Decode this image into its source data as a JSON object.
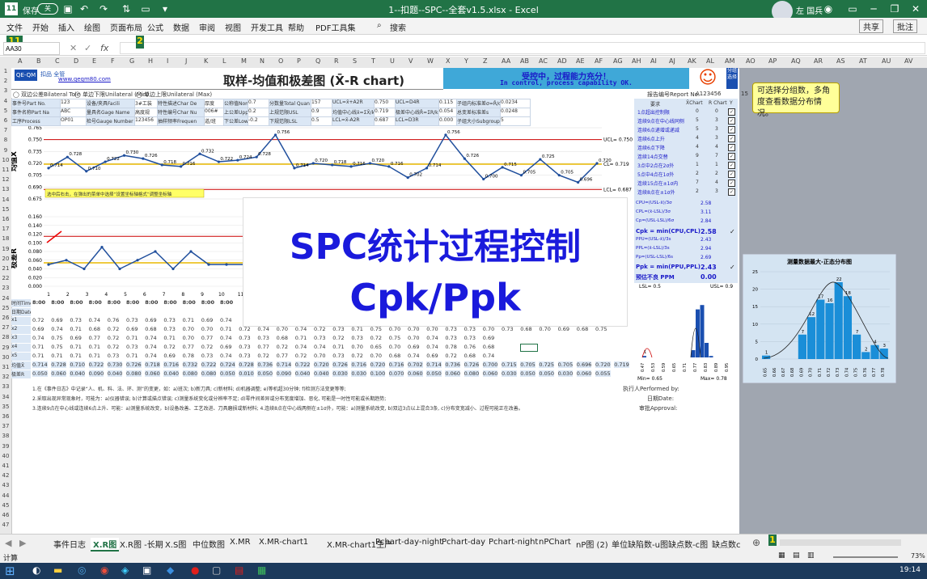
{
  "window": {
    "title": "1--扣题--SPC--全套v1.5.xlsx  -  Excel",
    "autosave": "保存",
    "autosave_state": "关",
    "user": "左 国兵"
  },
  "ribbon": {
    "tabs": [
      "文件",
      "开始",
      "插入",
      "绘图",
      "页面布局",
      "公式",
      "数据",
      "审阅",
      "视图",
      "开发工具",
      "帮助",
      "PDF工具集"
    ],
    "search": "搜索",
    "share": "共享",
    "comment": "批注"
  },
  "formula_bar": {
    "name_box": "AA30",
    "fx": "fx"
  },
  "markers": {
    "m1": "11",
    "m2": "2",
    "m3": "1"
  },
  "columns": [
    "A",
    "B",
    "C",
    "D",
    "E",
    "F",
    "G",
    "H",
    "I",
    "J",
    "K",
    "L",
    "M",
    "N",
    "O",
    "P",
    "Q",
    "R",
    "S",
    "T",
    "U",
    "V",
    "W",
    "X",
    "Y",
    "Z",
    "AA",
    "AB",
    "AC",
    "AD",
    "AE",
    "AF",
    "AG",
    "AH",
    "AI",
    "AJ",
    "AK",
    "AL",
    "AM",
    "AN",
    "AO",
    "AP",
    "AQ",
    "AR",
    "AS",
    "AT",
    "AU",
    "AV"
  ],
  "rows": [
    "1",
    "2",
    "3",
    "4",
    "5",
    "6",
    "7",
    "8",
    "9",
    "10",
    "11",
    "12",
    "13",
    "14",
    "15",
    "16",
    "17",
    "18",
    "19",
    "20",
    "21",
    "22",
    "23",
    "24",
    "25",
    "26",
    "27",
    "28",
    "29",
    "30",
    "31",
    "32",
    "33",
    "34",
    "35",
    "36",
    "37",
    "38",
    "39",
    "40",
    "41",
    "42",
    "43",
    "44",
    "45",
    "46",
    "47"
  ],
  "header": {
    "logo_text": "QE-QM",
    "logo_cn": "扣品 全管",
    "website": "www.qeqm80.com",
    "title": "取样-均值和极差图 (X̄-R chart)",
    "status_cn": "受控中，过程能力充分！",
    "status_en": "In control, process capability OK.",
    "smile": "☺",
    "side_label": "分组选择",
    "side_value": "15"
  },
  "options": [
    "双边公差Bilateral Tole",
    "单边下限Unilateral (Min)",
    "单边上限Unilateral (Max)"
  ],
  "report": {
    "label": "报告编号Report No.",
    "value": "A123456"
  },
  "info_rows": [
    [
      "事件号Part No.",
      "123",
      "设备/夹具Facili",
      "3#工装",
      "特性描述Char De",
      "厚度",
      "公称值Nomi Valu",
      "0.7",
      "分数量Total Quan",
      "157",
      "UCL=x̄+A2R",
      "0.750",
      "UCL=D4R̄",
      "0.115",
      "子组内标准差σ=R̄/d2",
      "0.0234"
    ],
    [
      "事件名称Part Na",
      "ABC",
      "量具名Gage Name",
      "高度规",
      "特性编号Char Nu",
      "006#",
      "上公差Upper Tol",
      "0.2",
      "上规范限USL",
      "0.9",
      "均值中心线x̄=ΣX̄/k",
      "0.719",
      "极差中心线R̄=ΣR/k",
      "0.054",
      "总变差标准差s",
      "0.0248"
    ],
    [
      "工序Process",
      "OP01",
      "检号Gauge Number",
      "123456",
      "抽样频率Frequen",
      "道/班",
      "下公差Lower Tol",
      "-0.2",
      "下规范限LSL",
      "0.5",
      "LCL=x̄-A2R",
      "0.687",
      "LCL=D3R",
      "0.000",
      "子组大小Subgroup Size",
      "5"
    ]
  ],
  "xbar_chart": {
    "label": "均值X",
    "y_ticks": [
      "0.765",
      "0.750",
      "0.735",
      "0.720",
      "0.705",
      "0.690",
      "0.675"
    ],
    "ucl_label": "UCL= 0.750",
    "cl_label": "CL= 0.719",
    "lcl_label": "LCL= 0.687",
    "values": [
      0.714,
      0.728,
      0.71,
      0.722,
      0.73,
      0.726,
      0.718,
      0.716,
      0.732,
      0.722,
      0.724,
      0.728,
      0.756,
      0.714,
      0.72,
      0.718,
      0.716,
      0.72,
      0.716,
      0.702,
      0.714,
      0.756,
      0.726,
      0.7,
      0.715,
      0.705,
      0.725,
      0.705,
      0.696,
      0.72
    ],
    "annotation": "选中后右击，在弹出的菜单中选择“设置坐标轴格式”调整坐标轴"
  },
  "r_chart": {
    "label": "极差R",
    "y_ticks": [
      "0.160",
      "0.140",
      "0.120",
      "0.100",
      "0.080",
      "0.060",
      "0.040",
      "0.020",
      "0.000"
    ],
    "values": [
      0.05,
      0.06,
      0.04,
      0.09,
      0.04,
      0.06,
      0.08,
      0.04,
      0.08,
      0.05,
      0.05,
      0.05
    ],
    "x_ticks": [
      "1",
      "2",
      "3",
      "4",
      "5",
      "6",
      "7",
      "8",
      "9",
      "10",
      "11"
    ]
  },
  "rules_panel": {
    "header": [
      "要求",
      "X̄Chart",
      "R Chart",
      "Y"
    ],
    "rows": [
      [
        "1点超出控制限",
        "0",
        "0"
      ],
      [
        "连续9点在中心线同侧",
        "5",
        "3"
      ],
      [
        "连续6点递增或递减",
        "5",
        "3"
      ],
      [
        "连续6点上升",
        "4",
        "3"
      ],
      [
        "连续6点下降",
        "4",
        "4"
      ],
      [
        "连续14点交替",
        "9",
        "7"
      ],
      [
        "3点中2点在2σ外",
        "1",
        "1"
      ],
      [
        "5点中4点在1σ外",
        "2",
        "2"
      ],
      [
        "连续15点在±1σ内",
        "7",
        "4"
      ],
      [
        "连续8点在±1σ外",
        "2",
        "3"
      ]
    ]
  },
  "capability": [
    [
      "CPU=(USL-x̄)/3σ",
      "2.58",
      ""
    ],
    [
      "CPL=(x̄-LSL)/3σ",
      "3.11",
      ""
    ],
    [
      "Cp=(USL-LSL)/6σ",
      "2.84",
      ""
    ],
    [
      "Cpk = min(CPU,CPL)",
      "2.58",
      "✓"
    ],
    [
      "PPU=(USL-x̄)/3s",
      "2.43",
      ""
    ],
    [
      "PPL=(x̄-LSL)/3s",
      "2.94",
      ""
    ],
    [
      "Pp=(USL-LSL)/6s",
      "2.69",
      ""
    ],
    [
      "Ppk = min(PPU,PPL)",
      "2.43",
      "✓"
    ],
    [
      "预估不良 PPM",
      "0.00",
      ""
    ]
  ],
  "overlay": {
    "line1": "SPC统计过程控制",
    "line2": "Cpk/Ppk"
  },
  "callout": "可选择分组数，多角度查看数据分布情况。",
  "data_table": {
    "row_labels": [
      "时间Time",
      "日期Date",
      "x1",
      "x2",
      "x3",
      "x4",
      "x5",
      "均值X̄",
      "极差R"
    ],
    "time_value": "8:00",
    "x1": [
      "0.72",
      "0.69",
      "0.73",
      "0.74",
      "0.76",
      "0.73",
      "0.69",
      "0.73",
      "0.71",
      "0.69",
      "0.74"
    ],
    "x2": [
      "0.69",
      "0.74",
      "0.71",
      "0.68",
      "0.72",
      "0.69",
      "0.68",
      "0.73",
      "0.70",
      "0.70",
      "0.71",
      "0.72",
      "0.74",
      "0.70",
      "0.74",
      "0.72",
      "0.73",
      "0.71",
      "0.75",
      "0.70",
      "0.70",
      "0.70",
      "0.73",
      "0.73",
      "0.70",
      "0.73",
      "0.68",
      "0.70",
      "0.69",
      "0.68",
      "0.75"
    ],
    "x3": [
      "0.74",
      "0.75",
      "0.69",
      "0.77",
      "0.72",
      "0.71",
      "0.74",
      "0.71",
      "0.70",
      "0.77",
      "0.74",
      "0.73",
      "0.73",
      "0.68",
      "0.71",
      "0.73",
      "0.72",
      "0.73",
      "0.72",
      "0.75",
      "0.70",
      "0.74",
      "0.73",
      "0.73",
      "0.69"
    ],
    "x4": [
      "0.71",
      "0.75",
      "0.71",
      "0.71",
      "0.72",
      "0.73",
      "0.74",
      "0.72",
      "0.77",
      "0.72",
      "0.69",
      "0.73",
      "0.77",
      "0.72",
      "0.74",
      "0.74",
      "0.71",
      "0.70",
      "0.65",
      "0.70",
      "0.69",
      "0.74",
      "0.78",
      "0.76",
      "0.68"
    ],
    "x5": [
      "0.71",
      "0.71",
      "0.71",
      "0.71",
      "0.73",
      "0.71",
      "0.74",
      "0.69",
      "0.78",
      "0.73",
      "0.74",
      "0.73",
      "0.72",
      "0.77",
      "0.72",
      "0.70",
      "0.73",
      "0.72",
      "0.70",
      "0.68",
      "0.74",
      "0.69",
      "0.72",
      "0.68",
      "0.74"
    ],
    "xbar": [
      "0.714",
      "0.728",
      "0.710",
      "0.722",
      "0.730",
      "0.726",
      "0.718",
      "0.716",
      "0.732",
      "0.722",
      "0.724",
      "0.728",
      "0.736",
      "0.714",
      "0.722",
      "0.720",
      "0.726",
      "0.716",
      "0.720",
      "0.716",
      "0.702",
      "0.714",
      "0.736",
      "0.726",
      "0.700",
      "0.715",
      "0.705",
      "0.725",
      "0.705",
      "0.696",
      "0.720",
      "0.719"
    ],
    "range": [
      "0.050",
      "0.060",
      "0.040",
      "0.090",
      "0.040",
      "0.080",
      "0.060",
      "0.040",
      "0.080",
      "0.080",
      "0.050",
      "0.010",
      "0.050",
      "0.090",
      "0.040",
      "0.040",
      "0.030",
      "0.030",
      "0.100",
      "0.070",
      "0.060",
      "0.050",
      "0.060",
      "0.080",
      "0.060",
      "0.030",
      "0.050",
      "0.050",
      "0.030",
      "0.060",
      "0.055"
    ]
  },
  "notes": [
    "1.在《事件日志》中记录“人、机、料、法、环、测”的变更，如：a)班次; b)新刀具; c)新材料; d)机器调整; e)等机超30分钟; f)检测方法变更等等;",
    "2.采取出现异常现象时，可能为：a)仪器错误; b)计算或描点错误; c)测量系统变化或分辨率不足; d)零件间差异或分布宽度增加、恶化, 可能是一时性可能或长期趋势;",
    "3.连续9点在中心线或连续6点上升、可能：a)测量系统改变，b)设备改善、工艺改进、刀具磨损或新材料;  4.连续8点在中心线两侧在±1σ外，可能：a)测量系统改变, b)双边3点以上混合3条, c)分布变宽减小、过程可能正在改善。"
  ],
  "signoff": {
    "performed": "执行人Performed by:",
    "date": "日期Date:",
    "approval": "审批Approval:"
  },
  "hist_small": {
    "title": "",
    "legend": [
      "LSL= 0.5",
      "USL= 0.9"
    ],
    "min_label": "Min= 0.65",
    "max_label": "Max= 0.78",
    "bars": [
      1,
      0,
      0,
      0,
      0,
      0,
      0,
      0,
      0,
      0,
      0,
      5,
      33,
      36,
      10,
      1,
      0,
      0,
      0,
      0
    ],
    "bar_labels": [
      "1",
      "",
      "",
      "",
      "",
      "",
      "",
      "",
      "",
      "",
      "",
      "",
      "",
      "",
      "",
      "",
      "",
      "",
      "",
      ""
    ],
    "x_ticks": [
      "0.47",
      "0.53",
      "0.59",
      "0.65",
      "0.71",
      "0.77",
      "0.83",
      "0.89",
      "0.95"
    ]
  },
  "hist_big": {
    "title": "测量数据最大-正态分布图",
    "y_ticks": [
      "25",
      "20",
      "15",
      "10",
      "5",
      "0"
    ],
    "bars": [
      1,
      0,
      0,
      0,
      7,
      12,
      17,
      16,
      22,
      18,
      7,
      2,
      4,
      3
    ],
    "bar_labels": [
      "1",
      "",
      "",
      "",
      "7",
      "12",
      "17",
      "16",
      "22",
      "18",
      "7",
      "2",
      "4",
      "3"
    ],
    "x_ticks": [
      "0.65",
      "0.66",
      "0.67",
      "0.68",
      "0.69",
      "0.70",
      "0.71",
      "0.72",
      "0.73",
      "0.74",
      "0.75",
      "0.76",
      "0.77",
      "0.78"
    ]
  },
  "sheet_tabs": [
    "事件日志",
    "X.R图",
    "X.R图 -长期",
    "X.S图",
    "中位数图",
    "X.MR",
    "X.MR-chart1",
    "X.MR-chart1生产",
    "Pchart-day-night",
    "Pchart-day",
    "Pchart-night",
    "nPChart",
    "nP图 (2)",
    "单位缺陷数-u图",
    "缺点数-c图",
    "缺点数c"
  ],
  "active_tab": "X.R图",
  "status": {
    "ready": "计算",
    "zoom": "73%"
  },
  "taskbar": {
    "time": "19:14"
  },
  "colors": {
    "excel_green": "#217346",
    "ucl_red": "#cc0000",
    "cl_yellow": "#e8b800",
    "series_blue": "#1f4e9c",
    "hist_blue": "#1a8ed8",
    "title_blue": "#1a1adc"
  }
}
